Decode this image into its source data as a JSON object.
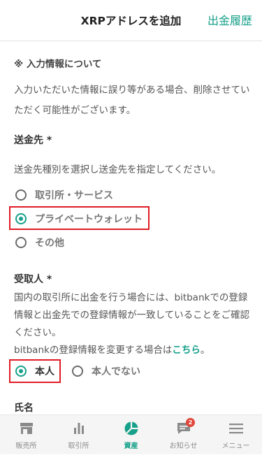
{
  "header": {
    "title": "XRPアドレスを追加",
    "link": "出金履歴"
  },
  "notice": {
    "title": "※ 入力情報について",
    "body": "入力いただいた情報に誤り等がある場合、削除させていただく可能性がございます。"
  },
  "destination": {
    "label": "送金先 *",
    "desc": "送金先種別を選択し送金先を指定してください。",
    "options": [
      "取引所・サービス",
      "プライベートウォレット",
      "その他"
    ],
    "selected": "プライベートウォレット"
  },
  "recipient": {
    "label": "受取人 *",
    "body": "国内の取引所に出金を行う場合には、bitbankでの登録情報と出金先での登録情報が一致していることをご確認ください。",
    "change_prefix": "bitbankの登録情報を変更する場合は",
    "change_link": "こちら",
    "change_suffix": "。",
    "options": [
      "本人",
      "本人でない"
    ],
    "selected": "本人"
  },
  "name_label": "氏名",
  "nav": {
    "items": [
      {
        "label": "販売所",
        "icon": "store-icon"
      },
      {
        "label": "取引所",
        "icon": "bar-chart-icon"
      },
      {
        "label": "資産",
        "icon": "pie-chart-icon"
      },
      {
        "label": "お知らせ",
        "icon": "chat-icon",
        "badge": "2"
      },
      {
        "label": "メニュー",
        "icon": "menu-icon"
      }
    ],
    "active": "資産"
  },
  "colors": {
    "accent": "#17a08a",
    "highlight_box": "#e01b24",
    "badge": "#e0463a"
  }
}
